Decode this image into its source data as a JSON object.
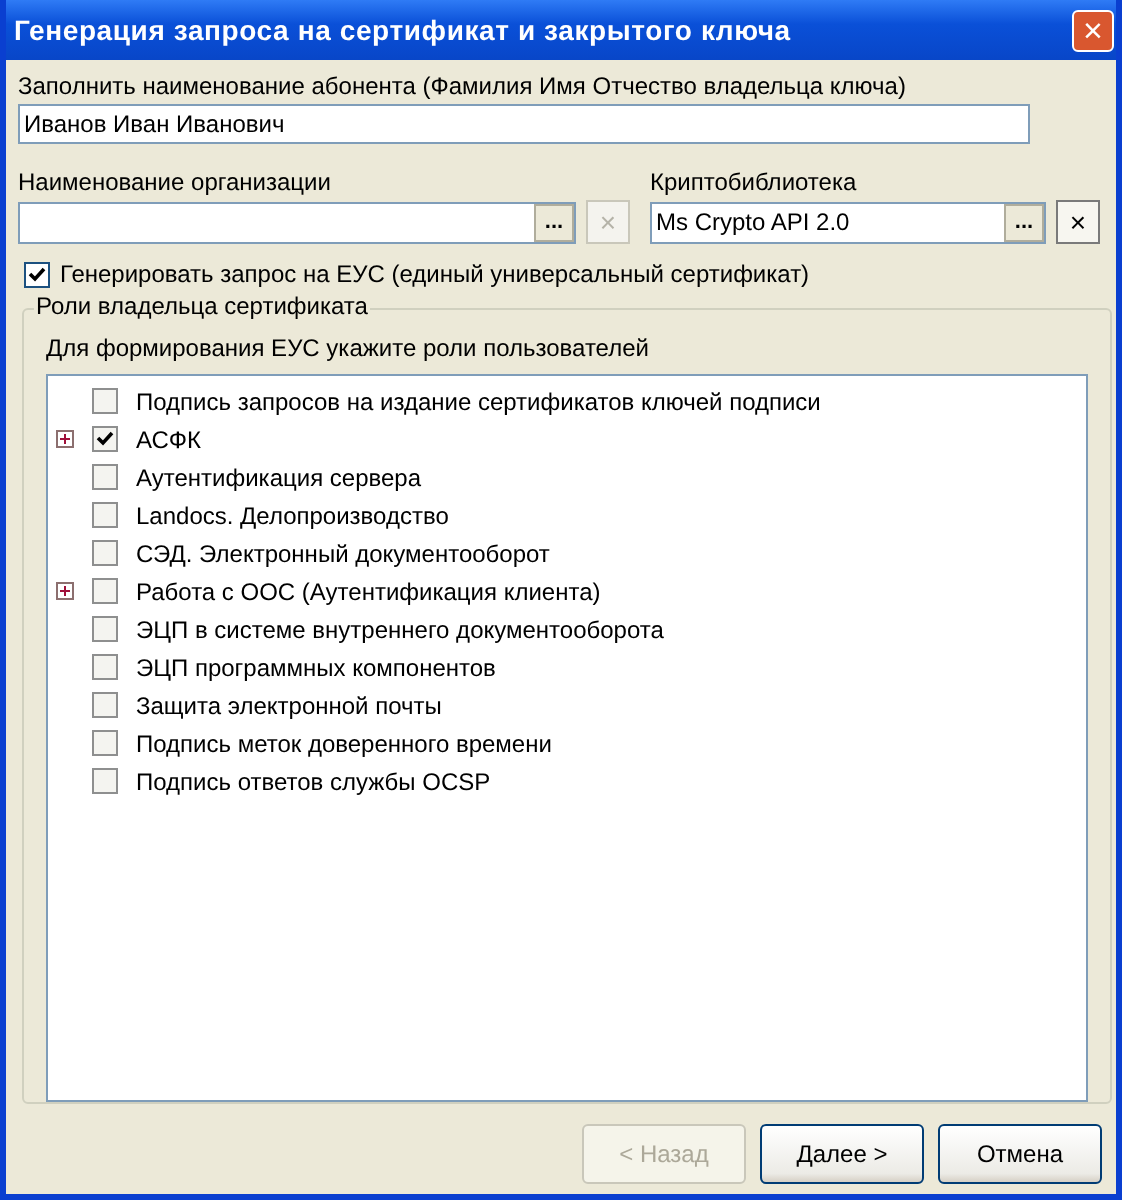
{
  "window": {
    "title": "Генерация запроса на сертификат и закрытого ключа",
    "close": "×"
  },
  "subscriber": {
    "label": "Заполнить наименование абонента (Фамилия Имя Отчество владельца ключа)",
    "value": "Иванов Иван Иванович"
  },
  "organization": {
    "label": "Наименование организации",
    "browse": "...",
    "clear": "×",
    "clear_disabled": true
  },
  "crypto_library": {
    "label": "Криптобиблиотека",
    "value": "Ms Crypto API 2.0",
    "browse": "...",
    "clear": "×",
    "clear_disabled": false
  },
  "universal_certificate": {
    "label": "Генерировать запрос на ЕУС (единый универсальный сертификат)",
    "checked": true
  },
  "roles": {
    "title": "Роли владельца сертификата",
    "hint": "Для формирования ЕУС укажите роли пользователей",
    "items": [
      {
        "label": "Подпись запросов на издание сертификатов ключей подписи",
        "checked": false,
        "expandable": false
      },
      {
        "label": "АСФК",
        "checked": true,
        "expandable": true
      },
      {
        "label": "Аутентификация сервера",
        "checked": false,
        "expandable": false
      },
      {
        "label": "Landocs. Делопроизводство",
        "checked": false,
        "expandable": false
      },
      {
        "label": "СЭД. Электронный документооборот",
        "checked": false,
        "expandable": false
      },
      {
        "label": "Работа с ООС (Аутентификация клиента)",
        "checked": false,
        "expandable": true
      },
      {
        "label": "ЭЦП в системе внутреннего документооборота",
        "checked": false,
        "expandable": false
      },
      {
        "label": "ЭЦП программных компонентов",
        "checked": false,
        "expandable": false
      },
      {
        "label": "Защита электронной почты",
        "checked": false,
        "expandable": false
      },
      {
        "label": "Подпись меток доверенного времени",
        "checked": false,
        "expandable": false
      },
      {
        "label": "Подпись ответов службы OCSP",
        "checked": false,
        "expandable": false
      }
    ]
  },
  "buttons": [
    {
      "label": "< Назад",
      "disabled": true
    },
    {
      "label": "Далее >",
      "disabled": false
    },
    {
      "label": "Отмена",
      "disabled": false
    }
  ]
}
